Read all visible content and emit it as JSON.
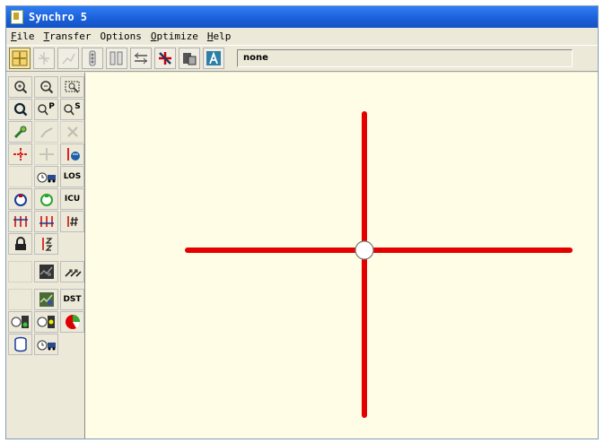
{
  "window": {
    "title": "Synchro 5"
  },
  "menubar": {
    "items": [
      {
        "accel": "F",
        "rest": "ile"
      },
      {
        "accel": "T",
        "rest": "ransfer"
      },
      {
        "accel": "",
        "rest": "Options"
      },
      {
        "accel": "O",
        "rest": "ptimize"
      },
      {
        "accel": "H",
        "rest": "elp"
      }
    ]
  },
  "toolbar": {
    "buttons": [
      "map-view-icon",
      "lanes-icon",
      "volumes-icon",
      "timing-icon",
      "phasing-icon",
      "simulation-icon",
      "detector-icon",
      "reports-icon",
      "sim-traffic-icon"
    ],
    "status_text": "none"
  },
  "sidebar": {
    "buttons": [
      {
        "icon": "zoom-in-icon"
      },
      {
        "icon": "zoom-out-icon"
      },
      {
        "icon": "zoom-window-icon"
      },
      {
        "icon": "zoom-all-icon"
      },
      {
        "icon": "zoom-previous-icon",
        "label": "P"
      },
      {
        "icon": "zoom-scale-icon",
        "label": "S"
      },
      {
        "icon": "add-link-icon"
      },
      {
        "icon": "add-bend-icon"
      },
      {
        "icon": "delete-icon"
      },
      {
        "icon": "node-icon"
      },
      {
        "icon": "node-move-icon"
      },
      {
        "icon": "node-settings-icon"
      },
      {
        "icon": "blank-icon"
      },
      {
        "icon": "vehicle-clock-icon"
      },
      {
        "icon": "los-icon",
        "label": "LOS"
      },
      {
        "icon": "signal-timer-icon"
      },
      {
        "icon": "signal-timer-green-icon"
      },
      {
        "icon": "icu-icon",
        "label": "ICU"
      },
      {
        "icon": "lane-config-icon"
      },
      {
        "icon": "lane-config2-icon"
      },
      {
        "icon": "lane-count-icon"
      },
      {
        "icon": "lock-icon"
      },
      {
        "icon": "sort-icon"
      },
      {
        "icon": "blank-icon"
      },
      {
        "icon": "map-pattern-icon"
      },
      {
        "icon": "flow-arrows-icon"
      },
      {
        "icon": "blank-icon"
      },
      {
        "icon": "map-pattern2-icon"
      },
      {
        "icon": "dst-icon",
        "label": "DST"
      },
      {
        "icon": "timer-green-icon"
      },
      {
        "icon": "timer-yellow-icon"
      },
      {
        "icon": "pie-chart-icon"
      },
      {
        "icon": "database-icon"
      },
      {
        "icon": "vehicle-clock2-icon"
      }
    ]
  },
  "intersection": {
    "link_color": "#e40000",
    "node_color": "#ffffff"
  }
}
